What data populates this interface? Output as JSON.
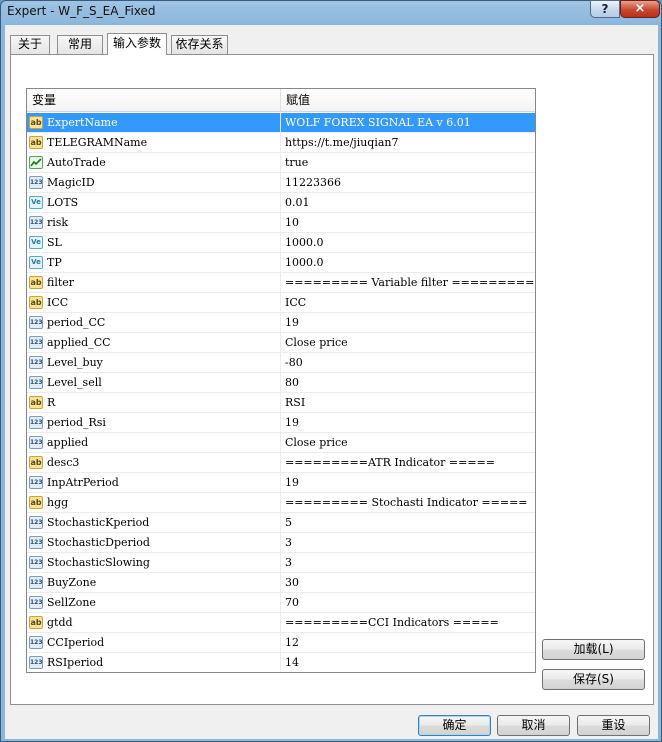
{
  "window": {
    "title": "Expert - W_F_S_EA_Fixed",
    "help": "?",
    "close": "×"
  },
  "tabs": [
    {
      "label": "关于"
    },
    {
      "label": "常用"
    },
    {
      "label": "输入参数"
    },
    {
      "label": "依存关系"
    }
  ],
  "table": {
    "headers": {
      "variable": "变量",
      "value": "赋值"
    },
    "rows": [
      {
        "icon": "ab",
        "name": "ExpertName",
        "value": " WOLF FOREX SIGNAL EA v 6.01",
        "selected": true
      },
      {
        "icon": "ab",
        "name": "TELEGRAMName",
        "value": " https://t.me/jiuqian7"
      },
      {
        "icon": "bool",
        "name": "AutoTrade",
        "value": "true"
      },
      {
        "icon": "123",
        "name": "MagicID",
        "value": "11223366"
      },
      {
        "icon": "Ve",
        "name": "LOTS",
        "value": "0.01"
      },
      {
        "icon": "123",
        "name": "risk",
        "value": "10"
      },
      {
        "icon": "Ve",
        "name": "SL",
        "value": "1000.0"
      },
      {
        "icon": "Ve",
        "name": "TP",
        "value": "1000.0"
      },
      {
        "icon": "ab",
        "name": "filter",
        "value": "========= Variable filter ========="
      },
      {
        "icon": "ab",
        "name": "ICC",
        "value": "ICC"
      },
      {
        "icon": "123",
        "name": "period_CC",
        "value": "19"
      },
      {
        "icon": "123",
        "name": "applied_CC",
        "value": "Close price"
      },
      {
        "icon": "123",
        "name": "Level_buy",
        "value": "-80"
      },
      {
        "icon": "123",
        "name": "Level_sell",
        "value": "80"
      },
      {
        "icon": "ab",
        "name": "R",
        "value": "RSI"
      },
      {
        "icon": "123",
        "name": "period_Rsi",
        "value": "19"
      },
      {
        "icon": "123",
        "name": "applied",
        "value": "Close price"
      },
      {
        "icon": "ab",
        "name": "desc3",
        "value": "=========ATR Indicator ====="
      },
      {
        "icon": "123",
        "name": "InpAtrPeriod",
        "value": "19"
      },
      {
        "icon": "ab",
        "name": "hgg",
        "value": "========= Stochasti Indicator ====="
      },
      {
        "icon": "123",
        "name": "StochasticKperiod",
        "value": "5"
      },
      {
        "icon": "123",
        "name": "StochasticDperiod",
        "value": "3"
      },
      {
        "icon": "123",
        "name": "StochasticSlowing",
        "value": "3"
      },
      {
        "icon": "123",
        "name": "BuyZone",
        "value": "30"
      },
      {
        "icon": "123",
        "name": "SellZone",
        "value": "70"
      },
      {
        "icon": "ab",
        "name": "gtdd",
        "value": "=========CCI Indicators ====="
      },
      {
        "icon": "123",
        "name": "CCIperiod",
        "value": "12"
      },
      {
        "icon": "123",
        "name": "RSIperiod",
        "value": "14"
      }
    ]
  },
  "side_buttons": {
    "load": "加载(L)",
    "save": "保存(S)"
  },
  "bottom_buttons": {
    "ok": "确定",
    "cancel": "取消",
    "reset": "重设"
  },
  "colors": {
    "selection": "#3399ff",
    "window_frame": "#8bb6dc",
    "close_button": "#c9462f"
  }
}
